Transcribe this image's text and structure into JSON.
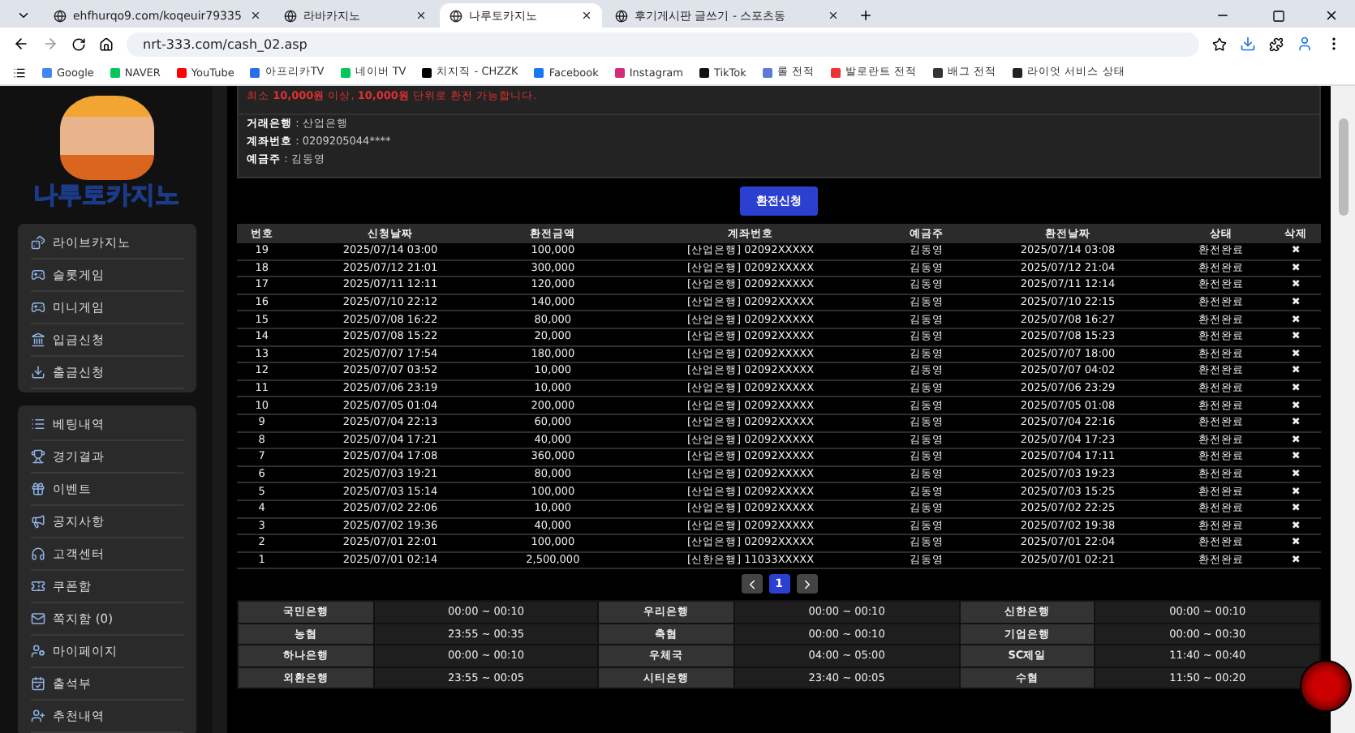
{
  "browser": {
    "tabs": [
      {
        "title": "ehfhurqo9.com/koqeuir79335",
        "selected": false
      },
      {
        "title": "라바카지노",
        "selected": false
      },
      {
        "title": "나루토카지노",
        "selected": true
      },
      {
        "title": "후기게시판 글쓰기 - 스포츠동",
        "selected": false
      }
    ],
    "address": "nrt-333.com/cash_02.asp",
    "bookmarks": [
      "Google",
      "NAVER",
      "YouTube",
      "아프리카TV",
      "네이버 TV",
      "치지직 - CHZZK",
      "Facebook",
      "Instagram",
      "TikTok",
      "롤 전적",
      "발로란트 전적",
      "배그 전적",
      "라이엇 서비스 상태"
    ]
  },
  "sidebar": {
    "logo": "나루토카지노",
    "groups": [
      {
        "items": [
          "라이브카지노",
          "슬롯게임",
          "미니게임",
          "입금신청",
          "출금신청"
        ]
      },
      {
        "items": [
          "베팅내역",
          "경기결과",
          "이벤트",
          "공지사항",
          "고객센터",
          "쿠폰함",
          "쪽지함 (0)",
          "마이페이지",
          "출석부",
          "추천내역"
        ]
      }
    ]
  },
  "notice": "최소 **10,000원** 이상, **10,000원** 단위로 환전 가능합니다.",
  "account": [
    {
      "label": "거래은행",
      "value": ": 산업은행"
    },
    {
      "label": "계좌번호",
      "value": ": 0209205044****"
    },
    {
      "label": "예금주",
      "value": ": 김동영"
    }
  ],
  "submit_button": "환전신청",
  "history": {
    "columns": [
      "번호",
      "신청날짜",
      "환전금액",
      "계좌번호",
      "예금주",
      "환전날짜",
      "상태",
      "삭제"
    ],
    "rows": [
      [
        "19",
        "2025/07/14 03:00",
        "100,000",
        "[산업은행] 02092XXXXX",
        "김동영",
        "2025/07/14 03:08",
        "환전완료",
        "✖"
      ],
      [
        "18",
        "2025/07/12 21:01",
        "300,000",
        "[산업은행] 02092XXXXX",
        "김동영",
        "2025/07/12 21:04",
        "환전완료",
        "✖"
      ],
      [
        "17",
        "2025/07/11 12:11",
        "120,000",
        "[산업은행] 02092XXXXX",
        "김동영",
        "2025/07/11 12:14",
        "환전완료",
        "✖"
      ],
      [
        "16",
        "2025/07/10 22:12",
        "140,000",
        "[산업은행] 02092XXXXX",
        "김동영",
        "2025/07/10 22:15",
        "환전완료",
        "✖"
      ],
      [
        "15",
        "2025/07/08 16:22",
        "80,000",
        "[산업은행] 02092XXXXX",
        "김동영",
        "2025/07/08 16:27",
        "환전완료",
        "✖"
      ],
      [
        "14",
        "2025/07/08 15:22",
        "20,000",
        "[산업은행] 02092XXXXX",
        "김동영",
        "2025/07/08 15:23",
        "환전완료",
        "✖"
      ],
      [
        "13",
        "2025/07/07 17:54",
        "180,000",
        "[산업은행] 02092XXXXX",
        "김동영",
        "2025/07/07 18:00",
        "환전완료",
        "✖"
      ],
      [
        "12",
        "2025/07/07 03:52",
        "10,000",
        "[산업은행] 02092XXXXX",
        "김동영",
        "2025/07/07 04:02",
        "환전완료",
        "✖"
      ],
      [
        "11",
        "2025/07/06 23:19",
        "10,000",
        "[산업은행] 02092XXXXX",
        "김동영",
        "2025/07/06 23:29",
        "환전완료",
        "✖"
      ],
      [
        "10",
        "2025/07/05 01:04",
        "200,000",
        "[산업은행] 02092XXXXX",
        "김동영",
        "2025/07/05 01:08",
        "환전완료",
        "✖"
      ],
      [
        "9",
        "2025/07/04 22:13",
        "60,000",
        "[산업은행] 02092XXXXX",
        "김동영",
        "2025/07/04 22:16",
        "환전완료",
        "✖"
      ],
      [
        "8",
        "2025/07/04 17:21",
        "40,000",
        "[산업은행] 02092XXXXX",
        "김동영",
        "2025/07/04 17:23",
        "환전완료",
        "✖"
      ],
      [
        "7",
        "2025/07/04 17:08",
        "360,000",
        "[산업은행] 02092XXXXX",
        "김동영",
        "2025/07/04 17:11",
        "환전완료",
        "✖"
      ],
      [
        "6",
        "2025/07/03 19:21",
        "80,000",
        "[산업은행] 02092XXXXX",
        "김동영",
        "2025/07/03 19:23",
        "환전완료",
        "✖"
      ],
      [
        "5",
        "2025/07/03 15:14",
        "100,000",
        "[산업은행] 02092XXXXX",
        "김동영",
        "2025/07/03 15:25",
        "환전완료",
        "✖"
      ],
      [
        "4",
        "2025/07/02 22:06",
        "10,000",
        "[산업은행] 02092XXXXX",
        "김동영",
        "2025/07/02 22:25",
        "환전완료",
        "✖"
      ],
      [
        "3",
        "2025/07/02 19:36",
        "40,000",
        "[산업은행] 02092XXXXX",
        "김동영",
        "2025/07/02 19:38",
        "환전완료",
        "✖"
      ],
      [
        "2",
        "2025/07/01 22:01",
        "100,000",
        "[산업은행] 02092XXXXX",
        "김동영",
        "2025/07/01 22:04",
        "환전완료",
        "✖"
      ],
      [
        "1",
        "2025/07/01 02:14",
        "2,500,000",
        "[신한은행] 11033XXXXX",
        "김동영",
        "2025/07/01 02:21",
        "환전완료",
        "✖"
      ]
    ]
  },
  "pagination": {
    "pages": [
      {
        "label": "1",
        "selected": true
      }
    ]
  },
  "bank_hours": {
    "rows": [
      [
        "국민은행",
        "00:00 ~ 00:10",
        "우리은행",
        "00:00 ~ 00:10",
        "신한은행",
        "00:00 ~ 00:10"
      ],
      [
        "농협",
        "23:55 ~ 00:35",
        "축협",
        "00:00 ~ 00:10",
        "기업은행",
        "00:00 ~ 00:30"
      ],
      [
        "하나은행",
        "00:00 ~ 00:10",
        "우체국",
        "04:00 ~ 05:00",
        "SC제일",
        "11:40 ~ 00:40"
      ],
      [
        "외환은행",
        "23:55 ~ 00:05",
        "시티은행",
        "23:40 ~ 00:05",
        "수협",
        "11:50 ~ 00:20"
      ]
    ]
  }
}
